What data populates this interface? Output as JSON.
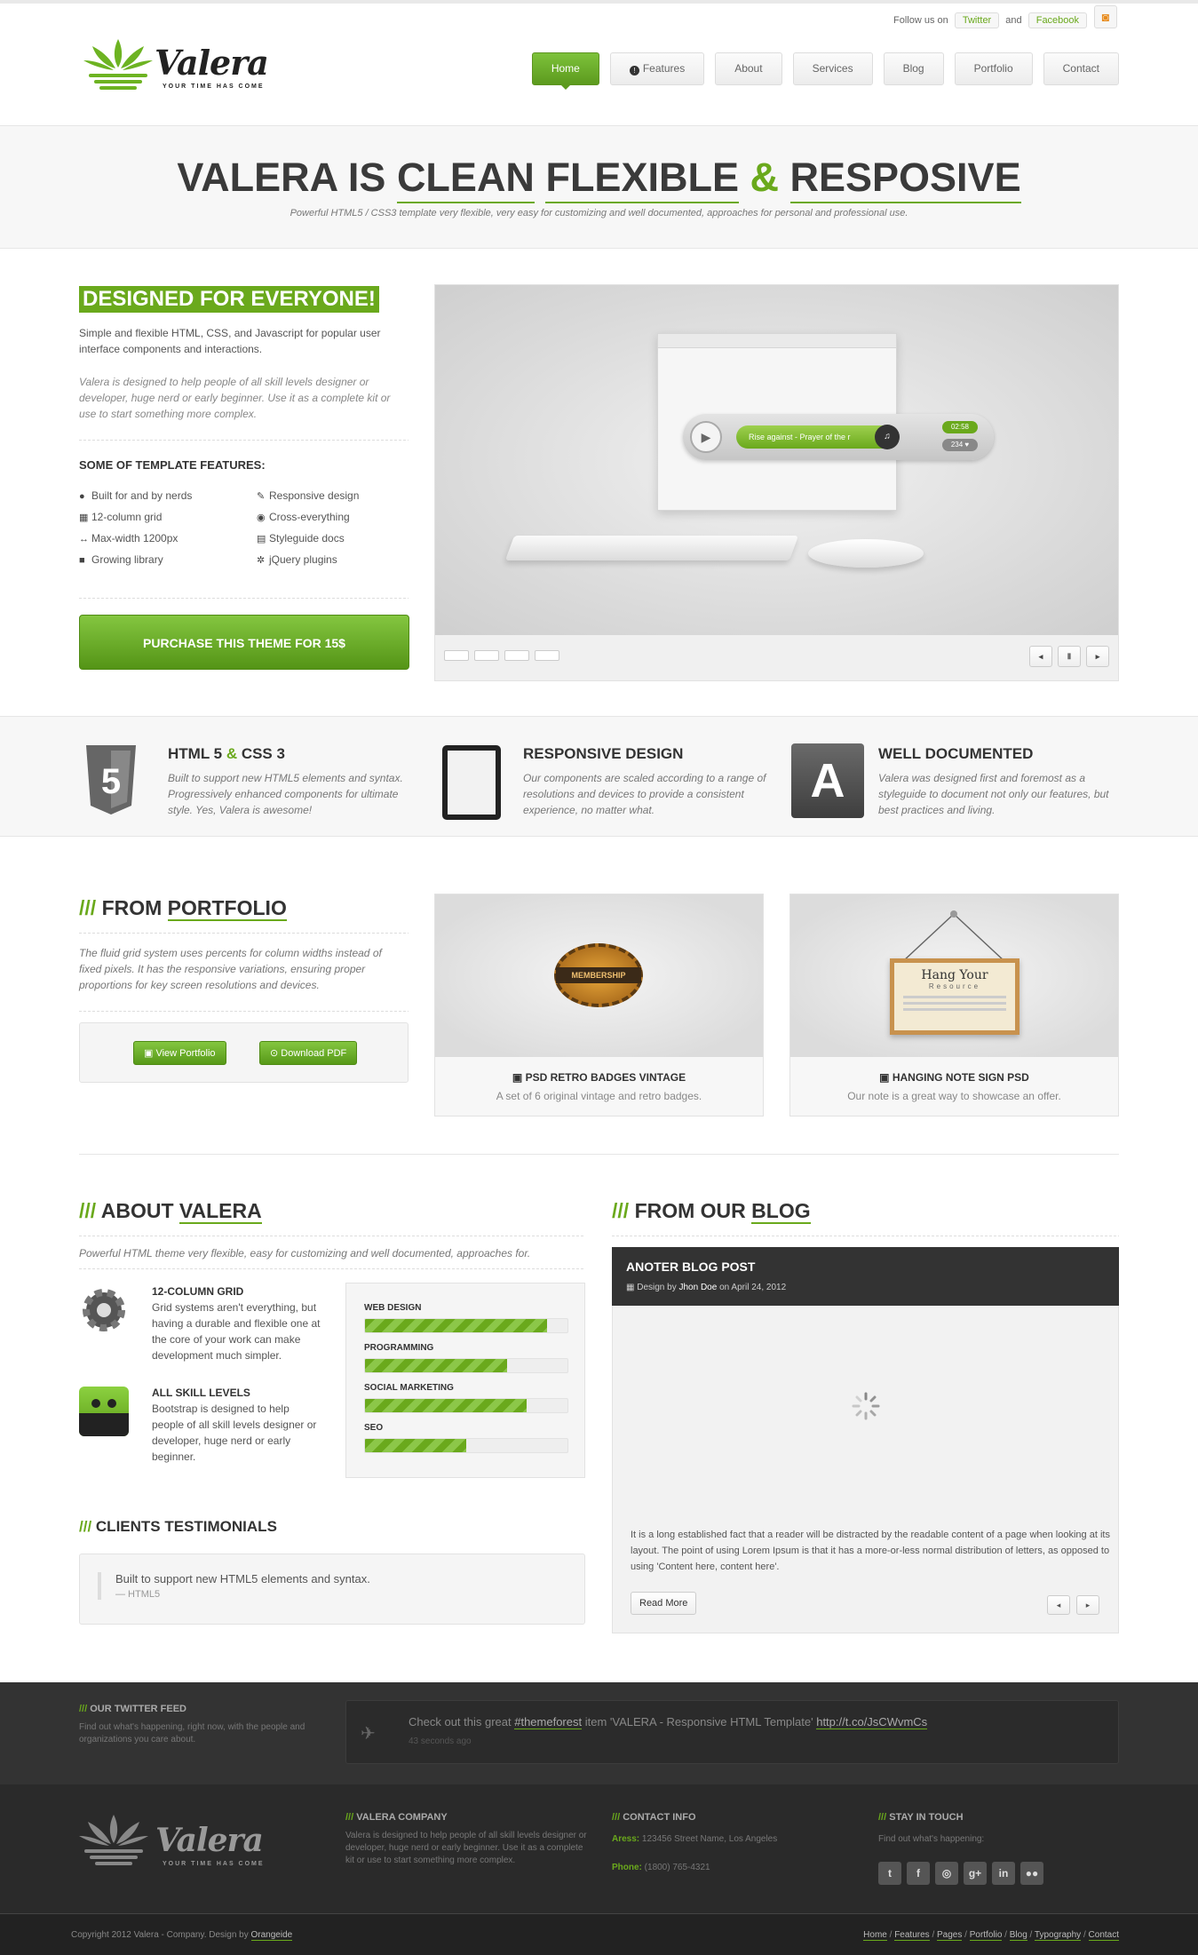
{
  "topbar": {
    "follow_label": "Follow us on",
    "twitter": "Twitter",
    "and": "and",
    "facebook": "Facebook"
  },
  "brand": {
    "name": "Valera",
    "tagline": "YOUR TIME HAS COME",
    "accent": "#6aa91c"
  },
  "nav": [
    "Home",
    "Features",
    "About",
    "Services",
    "Blog",
    "Portfolio",
    "Contact"
  ],
  "hero": {
    "part1": "VALERA IS ",
    "word1": "CLEAN",
    "word2": "FLEXIBLE",
    "amp": "&",
    "word3": "RESPOSIVE",
    "subtitle": "Powerful HTML5 / CSS3 template very flexible, very easy for customizing and well documented, approaches for personal and professional use."
  },
  "intro": {
    "badge": "DESIGNED FOR EVERYONE!",
    "p1": "Simple and flexible HTML, CSS, and Javascript for popular user interface components and interactions.",
    "p2": "Valera is designed to help people of all skill levels designer or developer, huge nerd or early beginner. Use it as a complete kit or use to start something more complex.",
    "features_title": "SOME OF TEMPLATE FEATURES:",
    "features": [
      "Built for and by nerds",
      "Responsive design",
      "12-column grid",
      "Cross-everything",
      "Max-width 1200px",
      "Styleguide docs",
      "Growing library",
      "jQuery plugins"
    ],
    "buy": "PURCHASE THIS THEME FOR 15$"
  },
  "slider": {
    "player_track": "Rise against - Prayer of the r",
    "time": "02:58",
    "count": "234 ♥"
  },
  "band": [
    {
      "title_a": "HTML 5 ",
      "amp": "&",
      "title_b": " CSS 3",
      "text": "Built to support new HTML5 elements and syntax. Progressively enhanced components for ultimate style. Yes, Valera is awesome!"
    },
    {
      "title_a": "RESPONSIVE DESIGN",
      "amp": "",
      "title_b": "",
      "text": "Our components are scaled according to a range of resolutions and devices to provide a consistent experience, no matter what."
    },
    {
      "title_a": "WELL DOCUMENTED",
      "amp": "",
      "title_b": "",
      "text": "Valera was designed first and foremost as a styleguide to document not only our features, but best practices and living."
    }
  ],
  "portfolio": {
    "slashes": "///",
    "title_a": "FROM ",
    "title_b": "PORTFOLIO",
    "text": "The fluid grid system uses percents for column widths instead of fixed pixels. It has the responsive variations, ensuring proper proportions for key screen resolutions and devices.",
    "btn_view": "View Portfolio",
    "btn_pdf": "Download PDF",
    "items": [
      {
        "title": "PSD RETRO BADGES VINTAGE",
        "sub": "A set of 6 original vintage and retro badges.",
        "badge": "MEMBERSHIP"
      },
      {
        "title": "HANGING NOTE SIGN PSD",
        "sub": "Our note is a great way to showcase an offer.",
        "sign_a": "Hang Your",
        "sign_b": "Resource"
      }
    ]
  },
  "about": {
    "slashes": "///",
    "title_a": "ABOUT ",
    "title_b": "VALERA",
    "text": "Powerful HTML theme very flexible, easy for customizing and well documented, approaches for.",
    "blocks": [
      {
        "title": "12-COLUMN GRID",
        "text": "Grid systems aren't everything, but having a durable and flexible one at the core of your work can make development much simpler."
      },
      {
        "title": "ALL SKILL LEVELS",
        "text": "Bootstrap is designed to help people of all skill levels designer or developer, huge nerd or early beginner."
      }
    ],
    "skills": [
      {
        "label": "WEB DESIGN",
        "pct": 90
      },
      {
        "label": "PROGRAMMING",
        "pct": 70
      },
      {
        "label": "SOCIAL MARKETING",
        "pct": 80
      },
      {
        "label": "SEO",
        "pct": 50
      }
    ]
  },
  "testimonials": {
    "slashes": "///",
    "title": "CLIENTS TESTIMONIALS",
    "quote": "Built to support new HTML5 elements and syntax.",
    "author": "— HTML5"
  },
  "blog": {
    "slashes": "///",
    "title_a": "FROM OUR ",
    "title_b": "BLOG",
    "post_title": "ANOTER BLOG POST",
    "meta_a": "Design by ",
    "meta_author": "Jhon Doe",
    "meta_b": " on April 24, 2012",
    "text": "It is a long established fact that a reader will be distracted by the readable content of a page when looking at its layout. The point of using Lorem Ipsum is that it has a more-or-less normal distribution of letters, as opposed to using 'Content here, content here'.",
    "read_more": "Read More"
  },
  "twitter_feed": {
    "slashes": "///",
    "title": "OUR TWITTER FEED",
    "text": "Find out what's happening, right now, with the people and organizations you care about.",
    "tweet_a": "Check out this great ",
    "tweet_tag": "#themeforest",
    "tweet_b": " item 'VALERA - Responsive HTML Template' ",
    "tweet_link": "http://t.co/JsCWvmCs",
    "ago": "43 seconds ago"
  },
  "footer": {
    "company_title": "VALERA COMPANY",
    "company_text": "Valera is designed to help people of all skill levels designer or developer, huge nerd or early beginner. Use it as a complete kit or use to start something more complex.",
    "contact_title": "CONTACT INFO",
    "address_label": "Aress:",
    "address": "123456 Street Name, Los Angeles",
    "phone_label": "Phone:",
    "phone": "(1800) 765-4321",
    "touch_title": "STAY IN TOUCH",
    "touch_text": "Find out what's happening:",
    "social": [
      "twitter-icon",
      "facebook-icon",
      "dribbble-icon",
      "google-plus-icon",
      "linkedin-icon",
      "flickr-icon"
    ],
    "copyright_a": "Copyright 2012 Valera - Company. Design by ",
    "copyright_b": "Orangeide",
    "links": [
      "Home",
      "Features",
      "Pages",
      "Portfolio",
      "Blog",
      "Typography",
      "Contact"
    ]
  }
}
